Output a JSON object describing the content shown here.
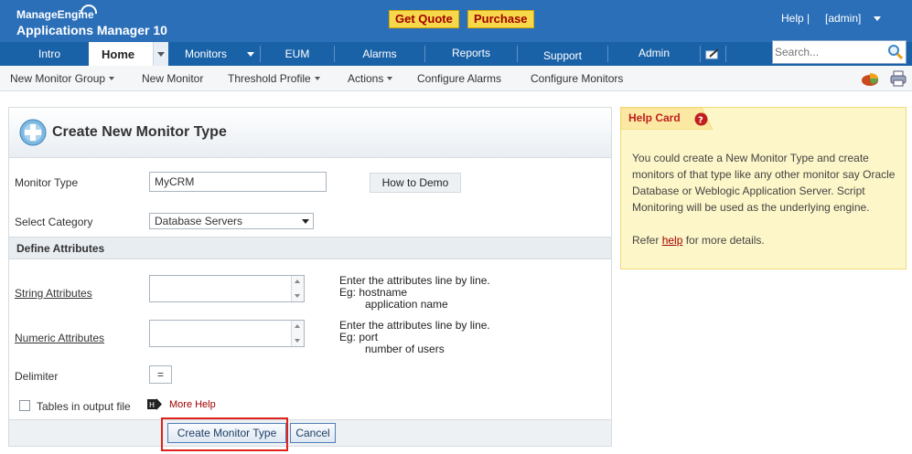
{
  "header": {
    "brand_top": "ManageEngine",
    "brand_bottom": "Applications Manager 10",
    "get_quote": "Get Quote",
    "purchase": "Purchase",
    "help": "Help |",
    "admin": "[admin]"
  },
  "nav": {
    "tabs": [
      "Intro",
      "Home",
      "Monitors",
      "EUM",
      "Alarms",
      "Reports",
      "Support",
      "Admin"
    ],
    "search_placeholder": "Search..."
  },
  "subnav": {
    "items": [
      "New Monitor Group",
      "New Monitor",
      "Threshold Profile",
      "Actions",
      "Configure Alarms",
      "Configure Monitors"
    ]
  },
  "form": {
    "title": "Create New Monitor Type",
    "monitor_type_label": "Monitor Type",
    "monitor_type_value": "MyCRM",
    "how_to_demo": "How to Demo",
    "category_label": "Select Category",
    "category_value": "Database Servers",
    "define_attributes": "Define Attributes",
    "string_label": "String Attributes",
    "string_hint": [
      "Enter the attributes line by line.",
      "Eg: hostname",
      "application name"
    ],
    "numeric_label": "Numeric Attributes",
    "numeric_hint": [
      "Enter the attributes line by line.",
      "Eg: port",
      "number of users"
    ],
    "delimiter_label": "Delimiter",
    "delimiter_value": "=",
    "tables_label": "Tables in output file",
    "more_help": "More Help",
    "create_button": "Create Monitor Type",
    "cancel_button": "Cancel"
  },
  "help_card": {
    "title": "Help Card",
    "body": "You could create a New Monitor Type and create monitors of that type like any other monitor say Oracle Database or Weblogic Application Server. Script Monitoring will be used as the underlying engine.",
    "refer_prefix": "Refer",
    "refer_link": "help",
    "refer_suffix": "for more details."
  },
  "colors": {
    "header_blue": "#2a6fb8",
    "nav_blue": "#1a62a8",
    "quote_yellow": "#f7d84a",
    "highlight_red": "#e0211c",
    "helpcard_bg": "#fdf6c8"
  }
}
